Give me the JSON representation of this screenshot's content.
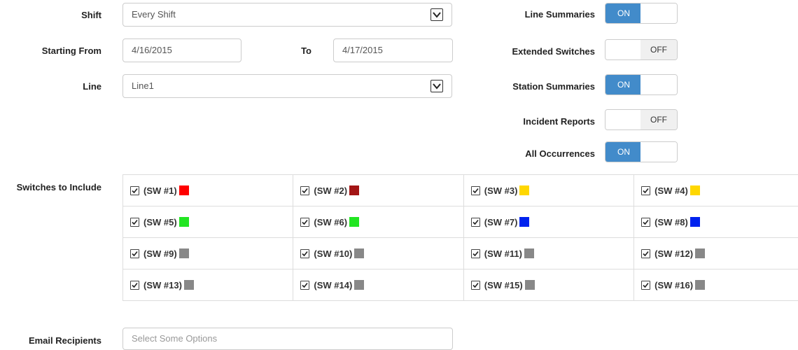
{
  "form": {
    "shift": {
      "label": "Shift",
      "value": "Every Shift"
    },
    "starting_from": {
      "label": "Starting From",
      "value": "4/16/2015"
    },
    "to": {
      "label": "To",
      "value": "4/17/2015"
    },
    "line": {
      "label": "Line",
      "value": "Line1"
    },
    "switches_label": "Switches to Include",
    "email": {
      "label": "Email Recipients",
      "placeholder": "Select Some Options"
    }
  },
  "toggles": [
    {
      "label": "Line Summaries",
      "state": "ON"
    },
    {
      "label": "Extended Switches",
      "state": "OFF"
    },
    {
      "label": "Station Summaries",
      "state": "ON"
    },
    {
      "label": "Incident Reports",
      "state": "OFF"
    },
    {
      "label": "All Occurrences",
      "state": "ON"
    }
  ],
  "switches": [
    {
      "label": "(SW #1)",
      "color": "#ff0000",
      "checked": true
    },
    {
      "label": "(SW #2)",
      "color": "#a31515",
      "checked": true
    },
    {
      "label": "(SW #3)",
      "color": "#ffd700",
      "checked": true
    },
    {
      "label": "(SW #4)",
      "color": "#ffd700",
      "checked": true
    },
    {
      "label": "(SW #5)",
      "color": "#22e522",
      "checked": true
    },
    {
      "label": "(SW #6)",
      "color": "#22e522",
      "checked": true
    },
    {
      "label": "(SW #7)",
      "color": "#0022ee",
      "checked": true
    },
    {
      "label": "(SW #8)",
      "color": "#0022ee",
      "checked": true
    },
    {
      "label": "(SW #9)",
      "color": "#888888",
      "checked": true
    },
    {
      "label": "(SW #10)",
      "color": "#888888",
      "checked": true
    },
    {
      "label": "(SW #11)",
      "color": "#888888",
      "checked": true
    },
    {
      "label": "(SW #12)",
      "color": "#888888",
      "checked": true
    },
    {
      "label": "(SW #13)",
      "color": "#888888",
      "checked": true
    },
    {
      "label": "(SW #14)",
      "color": "#888888",
      "checked": true
    },
    {
      "label": "(SW #15)",
      "color": "#888888",
      "checked": true
    },
    {
      "label": "(SW #16)",
      "color": "#888888",
      "checked": true
    }
  ]
}
